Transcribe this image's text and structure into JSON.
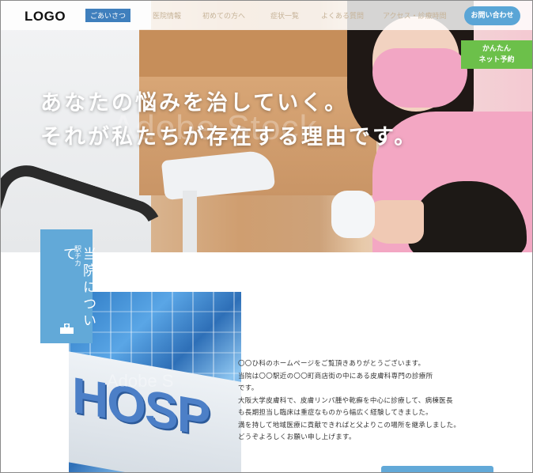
{
  "header": {
    "logo": "LOGO",
    "nav": [
      {
        "label": "ごあいさつ",
        "active": true
      },
      {
        "label": "医院情報",
        "active": false
      },
      {
        "label": "初めての方へ",
        "active": false
      },
      {
        "label": "症状一覧",
        "active": false
      },
      {
        "label": "よくある質問",
        "active": false
      },
      {
        "label": "アクセス・診療時間",
        "active": false
      }
    ],
    "contact_button": "お問い合わせ",
    "booking_button": {
      "line1": "かんたん",
      "line2": "ネット予約"
    }
  },
  "hero": {
    "line1": "あなたの悩みを治していく。",
    "line2": "それが私たちが存在する理由です。",
    "watermark": "Adobe Stock"
  },
  "about": {
    "tab_station": "駅チカ",
    "tab_title": "当院について",
    "photo_sign": "HOSP",
    "photo_watermark": "Adobe S",
    "intro_lines": [
      "〇〇ひ科のホームページをご覧頂きありがとうございます。",
      "当院は〇〇駅近の〇〇町商店街の中にある皮膚科専門の診療所",
      "です。",
      "大阪大学皮膚科で、皮膚リンパ腫や乾癬を中心に診療して、病棟医長",
      "も長期担当し臨床は重症なものから幅広く経験してきました。",
      "満を持して地域医療に貢献できればと父よりこの場所を継承しました。",
      "どうぞよろしくお願い申し上げます。"
    ]
  },
  "colors": {
    "accent_blue": "#62a9d8",
    "nav_active": "#3f7fbd",
    "booking_green": "#6cc04a",
    "nav_text": "#c6b398"
  }
}
